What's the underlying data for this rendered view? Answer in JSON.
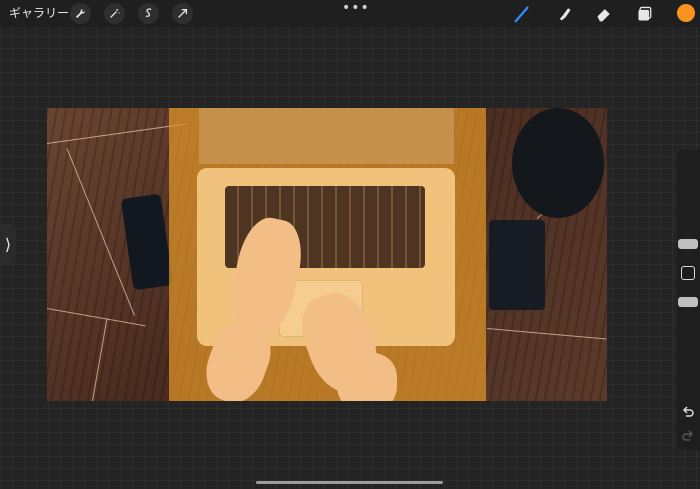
{
  "toolbar": {
    "gallery_label": "ギャラリー",
    "more_glyph": "•••",
    "color_accent": "#2f8fff",
    "current_color": "#f7931e"
  },
  "tools_left": [
    "wrench-icon",
    "magic-wand-icon",
    "selection-s-icon",
    "transform-arrow-icon"
  ],
  "tools_right": [
    "brush-icon",
    "smudge-icon",
    "eraser-icon",
    "layers-icon"
  ],
  "sidebar": {
    "expand_glyph": "⟩",
    "buttons": [
      "brush-size-slider",
      "modify-square-button",
      "opacity-slider",
      "undo-icon",
      "redo-icon"
    ]
  },
  "canvas": {
    "overlay_color": "#e29628"
  }
}
